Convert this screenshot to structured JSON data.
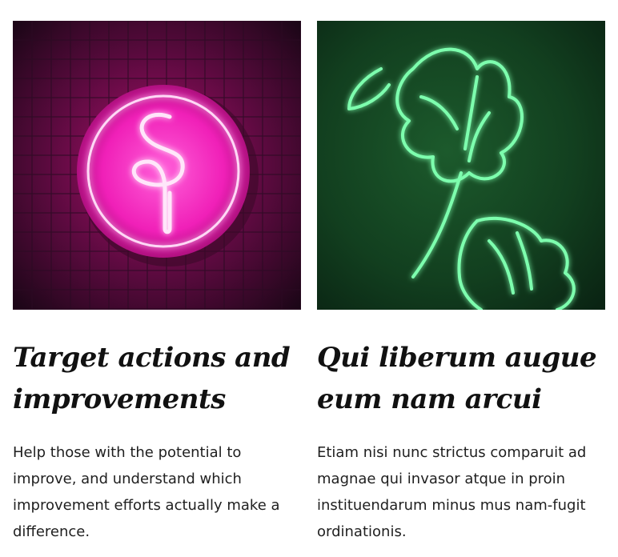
{
  "cards": [
    {
      "image_label": "pink neon flamingo sign",
      "title": "Target actions and improvements",
      "description": "Help those with the potential to improve, and understand which improvement efforts actually make a difference."
    },
    {
      "image_label": "green neon monstera leaf sign",
      "title": "Qui liberum augue eum nam arcui",
      "description": "Etiam nisi nunc strictus comparuit ad magnae qui invasor atque in proin instituendarum minus mus nam-fugit ordinationis."
    }
  ],
  "colors": {
    "pink_neon": "#ff3fd6",
    "green_neon": "#3dff8a",
    "title_text": "#111111",
    "body_text": "#1f1f1f"
  }
}
